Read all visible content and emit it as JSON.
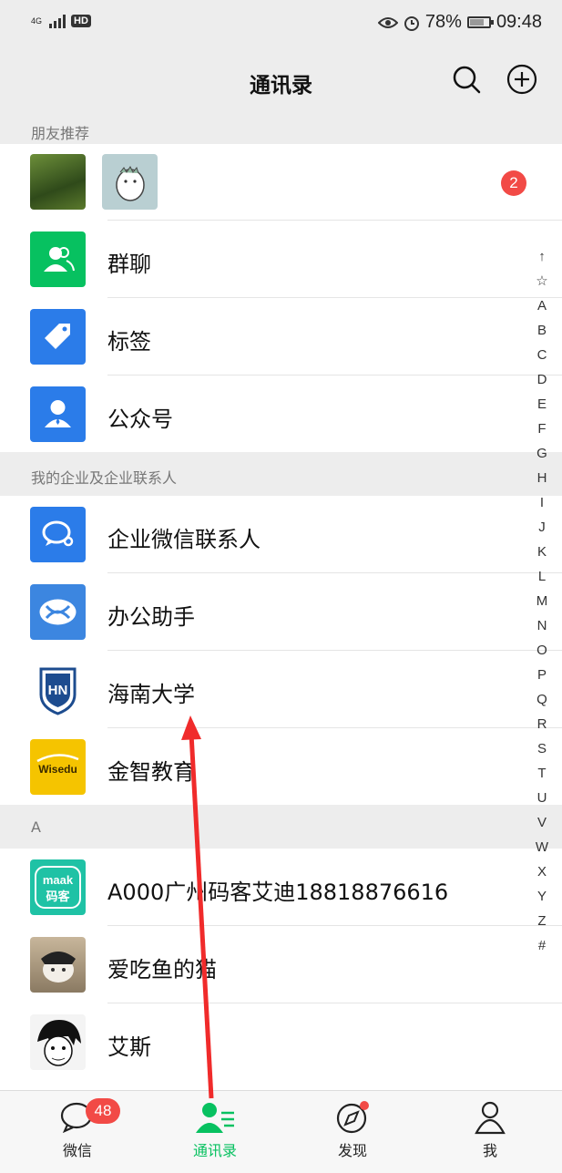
{
  "status_bar": {
    "network": "4G",
    "hd": "HD",
    "battery": "78%",
    "time": "09:48"
  },
  "nav": {
    "title": "通讯录"
  },
  "sections": {
    "friend_recommend": "朋友推荐",
    "enterprise": "我的企业及企业联系人",
    "letter_a": "A"
  },
  "friend_recommend": {
    "badge": "2"
  },
  "menu_items": [
    {
      "label": "群聊",
      "icon": "group-chat-icon",
      "color": "#07c160"
    },
    {
      "label": "标签",
      "icon": "tag-icon",
      "color": "#2b7ce9"
    },
    {
      "label": "公众号",
      "icon": "official-account-icon",
      "color": "#2b7ce9"
    }
  ],
  "enterprise_items": [
    {
      "label": "企业微信联系人",
      "icon": "wecom-icon",
      "color": "#2b7ce9"
    },
    {
      "label": "办公助手",
      "icon": "office-assistant-icon",
      "color": "#3c86e0"
    },
    {
      "label": "海南大学",
      "icon": "hainan-university-logo",
      "logo_text": "HN"
    },
    {
      "label": "金智教育",
      "icon": "wisedu-logo",
      "logo_text": "Wisedu",
      "color": "#f5c400"
    }
  ],
  "contacts": [
    {
      "label": "A000广州码客艾迪18818876616",
      "logo_text_top": "maak",
      "logo_text_bottom": "码客",
      "color": "#1fc2a5"
    },
    {
      "label": "爱吃鱼的猫"
    },
    {
      "label": "艾斯"
    }
  ],
  "index_letters": [
    "↑",
    "☆",
    "A",
    "B",
    "C",
    "D",
    "E",
    "F",
    "G",
    "H",
    "I",
    "J",
    "K",
    "L",
    "M",
    "N",
    "O",
    "P",
    "Q",
    "R",
    "S",
    "T",
    "U",
    "V",
    "W",
    "X",
    "Y",
    "Z",
    "#"
  ],
  "tabs": [
    {
      "label": "微信",
      "badge": "48"
    },
    {
      "label": "通讯录"
    },
    {
      "label": "发现"
    },
    {
      "label": "我"
    }
  ],
  "colors": {
    "accent": "#07c160",
    "badge": "#f24a46",
    "annotation_arrow": "#f02b2b"
  }
}
